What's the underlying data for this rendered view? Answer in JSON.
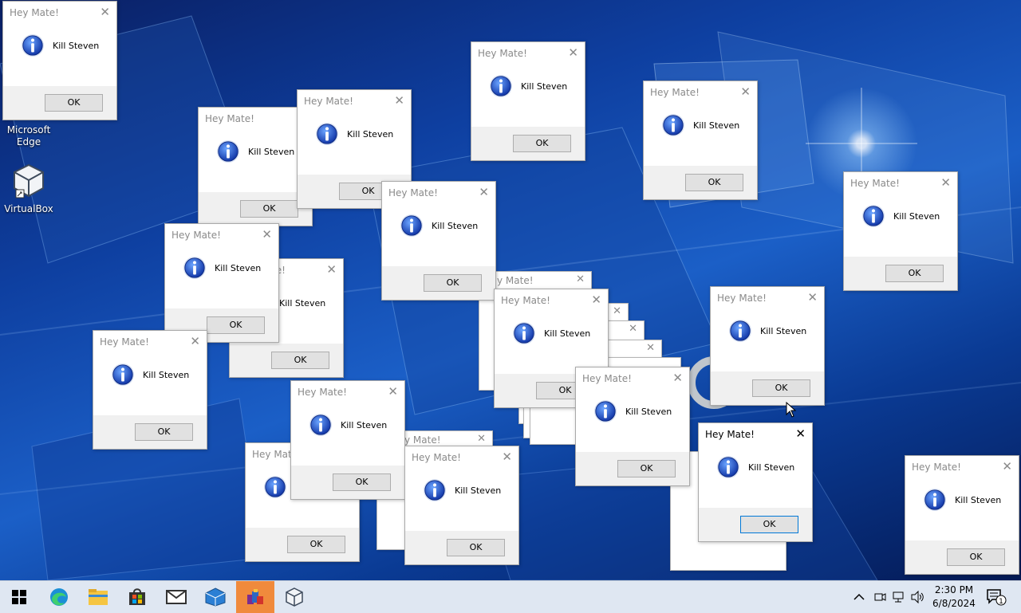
{
  "desktop": {
    "icons": [
      {
        "name": "microsoft-edge-desktop-icon",
        "label": "Microsoft Edge"
      },
      {
        "name": "virtualbox-desktop-icon",
        "label": "VirtualBox"
      }
    ]
  },
  "dialog": {
    "title": "Hey Mate!",
    "message": "Kill Steven",
    "ok_label": "OK",
    "close_glyph": "✕",
    "partial_title": "y Mate!"
  },
  "taskbar": {
    "start_icon": "windows-start-icon",
    "apps": [
      "edge-icon",
      "file-explorer-icon",
      "microsoft-store-icon",
      "mail-icon",
      "virtualbox-box-icon",
      "winrar-icon",
      "virtualbox-icon"
    ],
    "time": "2:30 PM",
    "date": "6/8/2024",
    "notification_count": "1"
  },
  "colors": {
    "accent": "#0078d7",
    "active_app_bg": "#f08a3c",
    "desktop_blue": "#0e3fa0"
  }
}
